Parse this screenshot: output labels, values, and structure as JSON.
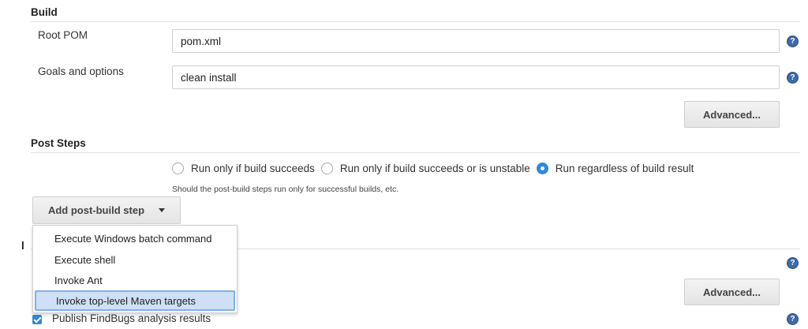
{
  "build": {
    "title": "Build",
    "root_pom": {
      "label": "Root POM",
      "value": "pom.xml"
    },
    "goals": {
      "label": "Goals and options",
      "value": "clean install"
    },
    "advanced_label": "Advanced..."
  },
  "post_steps": {
    "title": "Post Steps",
    "options": [
      {
        "label": "Run only if build succeeds",
        "checked": false
      },
      {
        "label": "Run only if build succeeds or is unstable",
        "checked": false
      },
      {
        "label": "Run regardless of build result",
        "checked": true
      }
    ],
    "hint": "Should the post-build steps run only for successful builds, etc.",
    "add_step_label": "Add post-build step"
  },
  "menu": {
    "items": [
      "Execute Windows batch command",
      "Execute shell",
      "Invoke Ant",
      "Invoke top-level Maven targets"
    ],
    "highlighted": "Invoke top-level Maven targets"
  },
  "lower": {
    "advanced_label": "Advanced...",
    "publish_findbugs": {
      "label": "Publish FindBugs analysis results",
      "checked": true
    }
  },
  "icons": {
    "help": "help-icon",
    "caret": "caret-down-icon",
    "checkbox": "checkbox-checked-icon"
  },
  "colors": {
    "accent": "#2f87e0",
    "help_icon": "#3d6aa8",
    "menu_highlight": "#cfe0f6",
    "menu_highlight_border": "#7fb0ee"
  }
}
